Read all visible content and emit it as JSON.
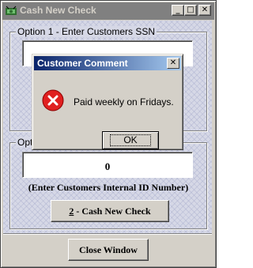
{
  "window": {
    "title": "Cash New Check",
    "minimize_glyph": "_",
    "maximize_glyph": "□",
    "close_glyph": "✕",
    "icon": "money-icon"
  },
  "option1": {
    "label": "Option 1 - Enter Customers SSN",
    "ssn_value": ""
  },
  "option2": {
    "label": "Option 2",
    "id_value": "0",
    "hint": "(Enter Customers Internal ID Number)",
    "cash_button_prefix": "2",
    "cash_button_rest": " - Cash New Check"
  },
  "close_button": "Close Window",
  "dialog": {
    "title": "Customer Comment",
    "close_glyph": "✕",
    "message": "Paid weekly on Fridays.",
    "ok_label": "OK",
    "icon": "error-icon"
  },
  "colors": {
    "dialog_title_start": "#0a246a",
    "dialog_title_end": "#a6caf0",
    "error_red": "#e02020",
    "inactive_title": "#808080"
  }
}
